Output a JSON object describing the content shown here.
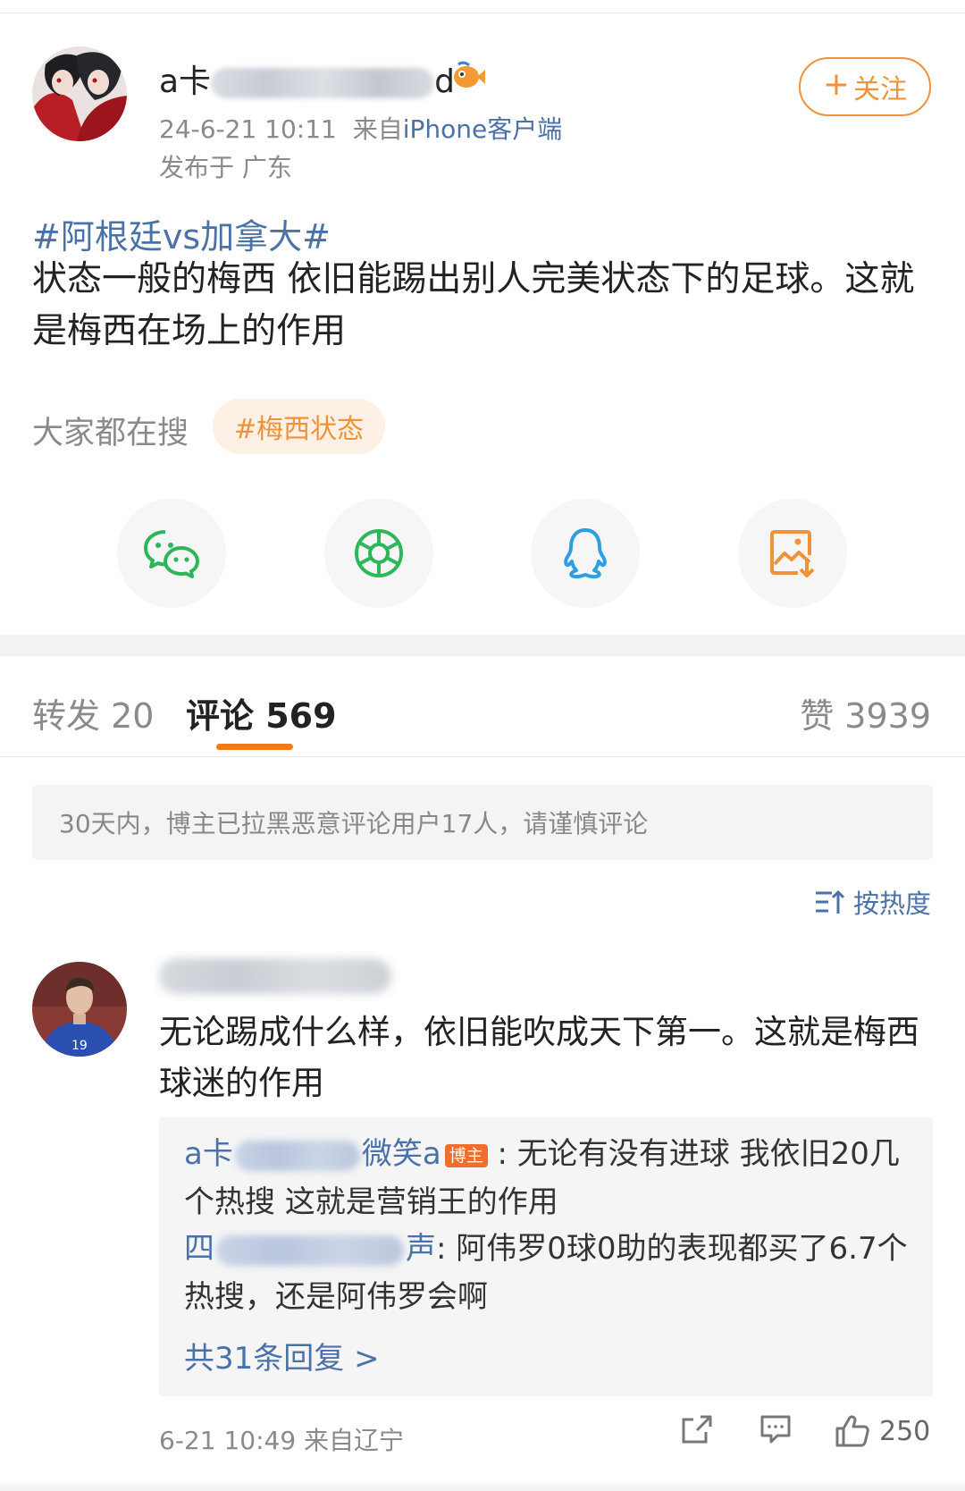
{
  "post": {
    "author": {
      "name_prefix": "a卡",
      "name_suffix": "d"
    },
    "time": "24-6-21 10:11",
    "source_prefix": "来自",
    "source_app": "iPhone客户端",
    "location": "发布于 广东",
    "follow_label": "关注",
    "hashtag": "#阿根廷vs加拿大#",
    "text": "状态一般的梅西 依旧能踢出别人完美状态下的足球。这就是梅西在场上的作用",
    "trending_label": "大家都在搜",
    "trending_chip": "#梅西状态"
  },
  "share": {
    "icons": [
      "wechat-icon",
      "moments-icon",
      "qq-icon",
      "save-image-icon"
    ],
    "colors": {
      "wechat": "#2db65a",
      "moments": "#2db65a",
      "qq": "#2b9fe0",
      "save": "#f0923a"
    }
  },
  "tabs": {
    "repost": "转发 20",
    "comments": "评论 569",
    "likes": "赞 3939"
  },
  "notice": "30天内，博主已拉黑恶意评论用户17人，请谨慎评论",
  "sort_label": "按热度",
  "comment": {
    "text": "无论踢成什么样，依旧能吹成天下第一。这就是梅西球迷的作用",
    "replies": [
      {
        "user_start": "a卡",
        "user_end": "微笑a",
        "badge": "博主",
        "text": "无论有没有进球 我依旧20几个热搜 这就是营销王的作用"
      },
      {
        "user_start": "四",
        "user_end": "声",
        "text": "阿伟罗0球0助的表现都买了6.7个热搜，还是阿伟罗会啊"
      }
    ],
    "more_replies": "共31条回复 >",
    "meta": "6-21 10:49 来自辽宁",
    "like_count": "250"
  },
  "accent_colors": {
    "link": "#4a72a8",
    "orange": "#f0923a"
  }
}
